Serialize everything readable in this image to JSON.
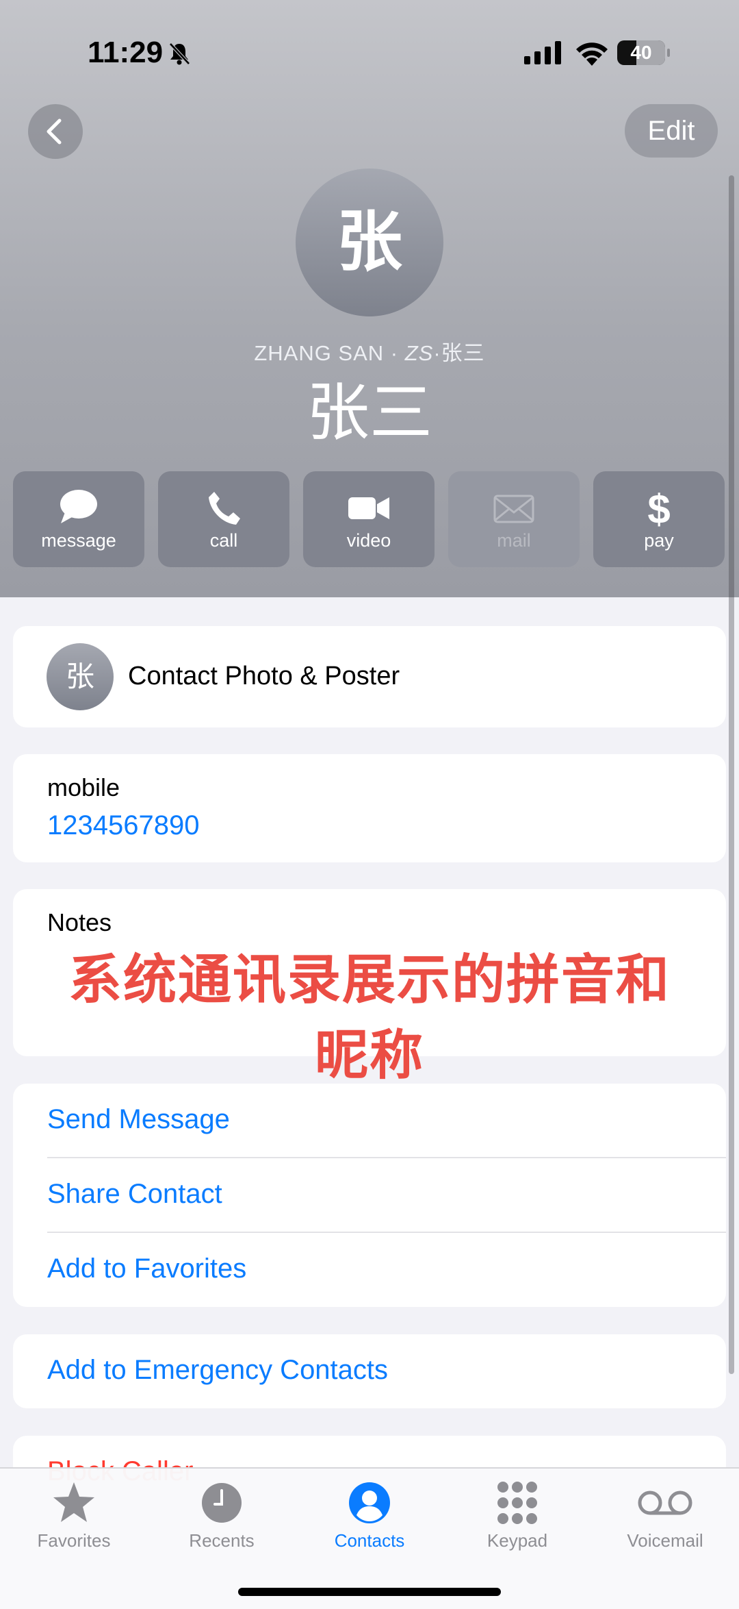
{
  "status": {
    "time": "11:29",
    "battery": "40"
  },
  "nav": {
    "edit_label": "Edit"
  },
  "contact": {
    "avatar_initial": "张",
    "phonetic_main": "ZHANG SAN · ",
    "phonetic_nick": "ZS",
    "phonetic_rest": "·张三",
    "name": "张三"
  },
  "actions": [
    {
      "label": "message",
      "icon": "message-bubble-icon",
      "enabled": true
    },
    {
      "label": "call",
      "icon": "phone-icon",
      "enabled": true
    },
    {
      "label": "video",
      "icon": "video-camera-icon",
      "enabled": true
    },
    {
      "label": "mail",
      "icon": "envelope-icon",
      "enabled": false
    },
    {
      "label": "pay",
      "icon": "dollar-icon",
      "enabled": true
    }
  ],
  "photo_poster": {
    "initial": "张",
    "label": "Contact Photo & Poster"
  },
  "phone": {
    "label": "mobile",
    "number": "1234567890"
  },
  "notes": {
    "label": "Notes"
  },
  "overlay_caption": {
    "line1": "系统通讯录展示的拼音和",
    "line2": "昵称"
  },
  "links": {
    "send_message": "Send Message",
    "share_contact": "Share Contact",
    "add_favorites": "Add to Favorites",
    "emergency": "Add to Emergency Contacts",
    "block": "Block Caller"
  },
  "tabs": [
    {
      "label": "Favorites",
      "icon": "star-icon",
      "active": false
    },
    {
      "label": "Recents",
      "icon": "clock-icon",
      "active": false
    },
    {
      "label": "Contacts",
      "icon": "person-circle-icon",
      "active": true
    },
    {
      "label": "Keypad",
      "icon": "keypad-icon",
      "active": false
    },
    {
      "label": "Voicemail",
      "icon": "voicemail-icon",
      "active": false
    }
  ],
  "colors": {
    "accent": "#0a7cff",
    "caption": "#eb4d44"
  }
}
